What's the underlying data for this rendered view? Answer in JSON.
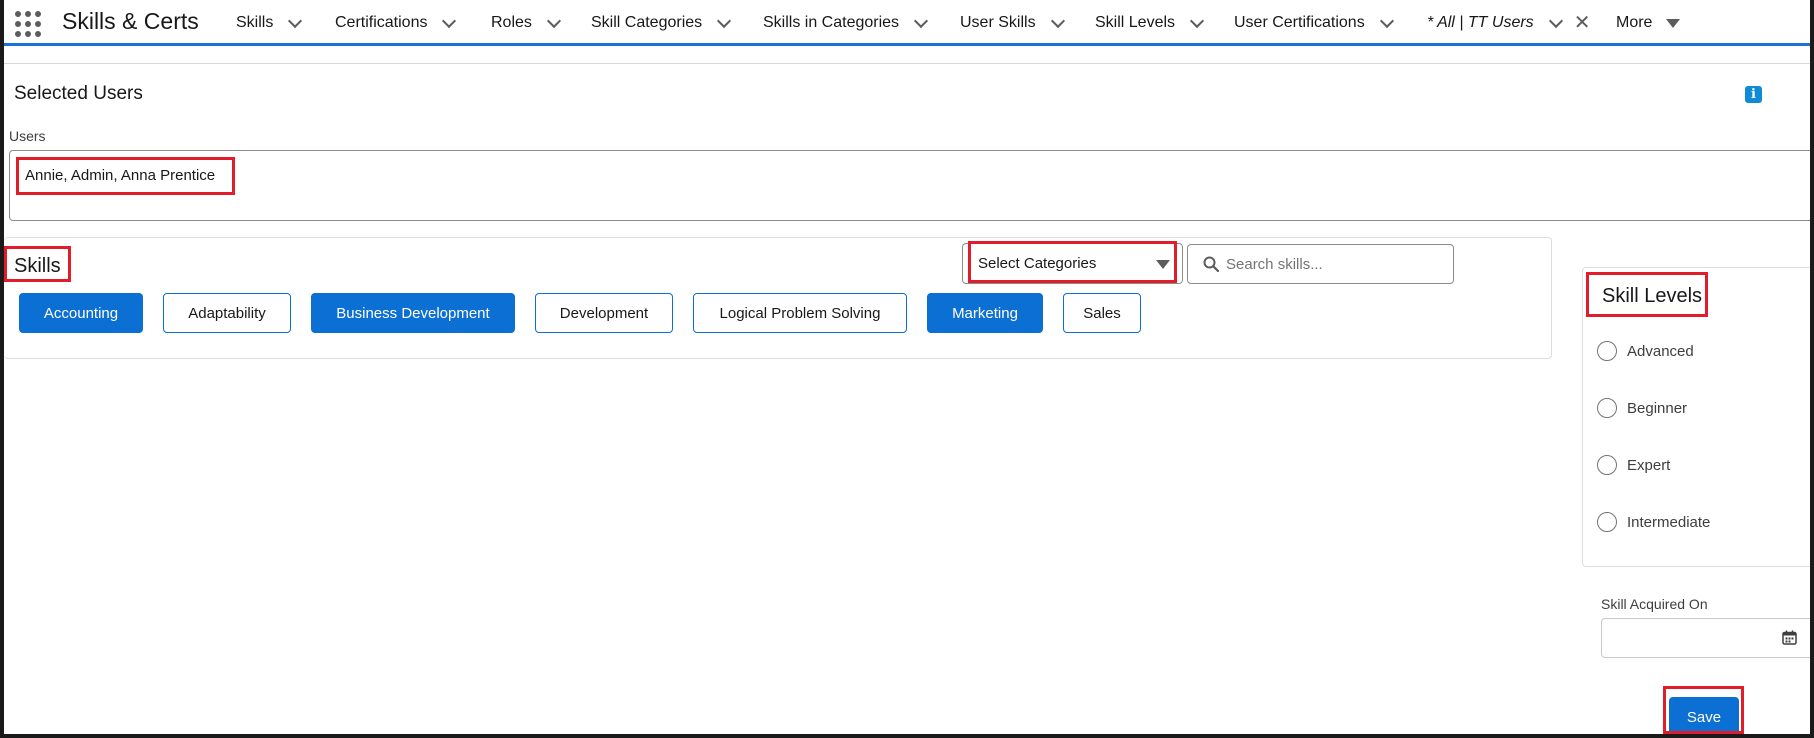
{
  "app": {
    "name": "Skills & Certs"
  },
  "nav": {
    "items": [
      {
        "label": "Skills"
      },
      {
        "label": "Certifications"
      },
      {
        "label": "Roles"
      },
      {
        "label": "Skill Categories"
      },
      {
        "label": "Skills in Categories"
      },
      {
        "label": "User Skills"
      },
      {
        "label": "Skill Levels"
      },
      {
        "label": "User Certifications"
      }
    ],
    "active_tab": {
      "label": "* All | TT Users"
    },
    "more": {
      "label": "More"
    }
  },
  "selected_users": {
    "title": "Selected Users",
    "users_label": "Users",
    "users_value": "Annie, Admin, Anna Prentice"
  },
  "skills": {
    "title": "Skills",
    "category_select": "Select Categories",
    "search_placeholder": "Search skills...",
    "pills": [
      {
        "label": "Accounting",
        "selected": true
      },
      {
        "label": "Adaptability",
        "selected": false
      },
      {
        "label": "Business Development",
        "selected": true
      },
      {
        "label": "Development",
        "selected": false
      },
      {
        "label": "Logical Problem Solving",
        "selected": false
      },
      {
        "label": "Marketing",
        "selected": true
      },
      {
        "label": "Sales",
        "selected": false
      }
    ]
  },
  "skill_levels": {
    "title": "Skill Levels",
    "options": [
      {
        "label": "Advanced",
        "checked": false
      },
      {
        "label": "Beginner",
        "checked": false
      },
      {
        "label": "Expert",
        "checked": false
      },
      {
        "label": "Intermediate",
        "checked": false
      }
    ]
  },
  "skill_acquired": {
    "label": "Skill Acquired On",
    "value": ""
  },
  "actions": {
    "save_label": "Save"
  },
  "colors": {
    "brand_blue": "#0b6fd3",
    "highlight_red": "#e21d2b",
    "info_blue": "#0f8bd6"
  }
}
